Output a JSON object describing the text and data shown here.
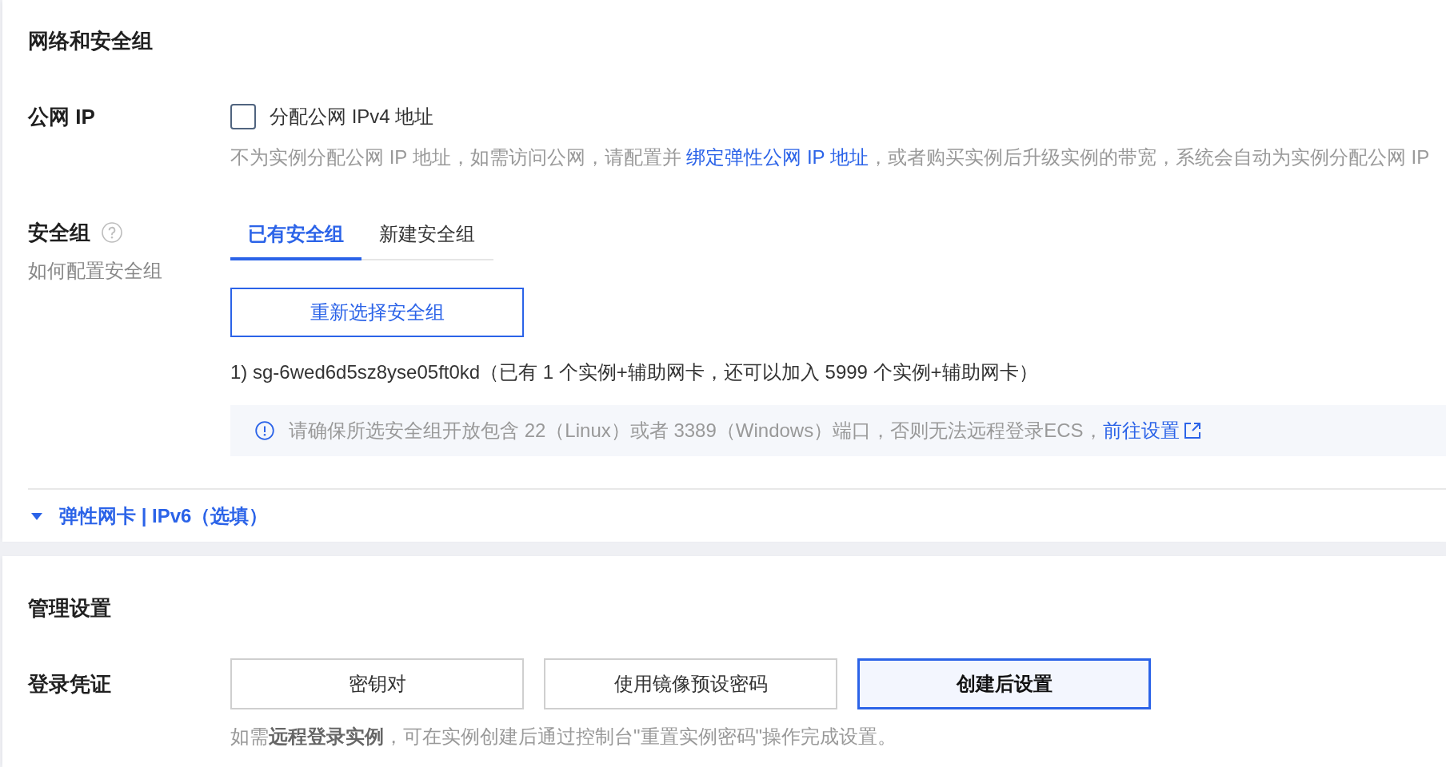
{
  "network_security": {
    "title": "网络和安全组",
    "public_ip": {
      "label": "公网 IP",
      "checkbox": {
        "label": "分配公网 IPv4 地址",
        "checked": false
      },
      "hint": [
        {
          "kind": "text",
          "text": "不为实例分配公网 IP 地址，如需访问公网，请配置并 "
        },
        {
          "kind": "link",
          "text": "绑定弹性公网 IP 地址"
        },
        {
          "kind": "text",
          "text": "，或者购买实例后升级实例的带宽，系统会自动为实例分配公网 IP"
        }
      ]
    },
    "security_group": {
      "label": "安全组",
      "help_link": "如何配置安全组",
      "tabs": [
        {
          "label": "已有安全组",
          "selected": true
        },
        {
          "label": "新建安全组",
          "selected": false
        }
      ],
      "reselect_button": "重新选择安全组",
      "selected_groups": [
        "1) sg-6wed6d5sz8yse05ft0kd（已有 1 个实例+辅助网卡，还可以加入 5999 个实例+辅助网卡）"
      ],
      "notice": {
        "text": "请确保所选安全组开放包含 22（Linux）或者 3389（Windows）端口，否则无法远程登录ECS，",
        "link": "前往设置"
      }
    },
    "elastic_nic_toggle": {
      "label": "弹性网卡 | IPv6（选填）"
    }
  },
  "management": {
    "title": "管理设置",
    "login_credential": {
      "label": "登录凭证",
      "options": [
        {
          "label": "密钥对",
          "selected": false
        },
        {
          "label": "使用镜像预设密码",
          "selected": false
        },
        {
          "label": "创建后设置",
          "selected": true
        }
      ],
      "hint": "如需**远程登录实例**，可在实例创建后通过控制台\"重置实例密码\"操作完成设置。"
    }
  }
}
